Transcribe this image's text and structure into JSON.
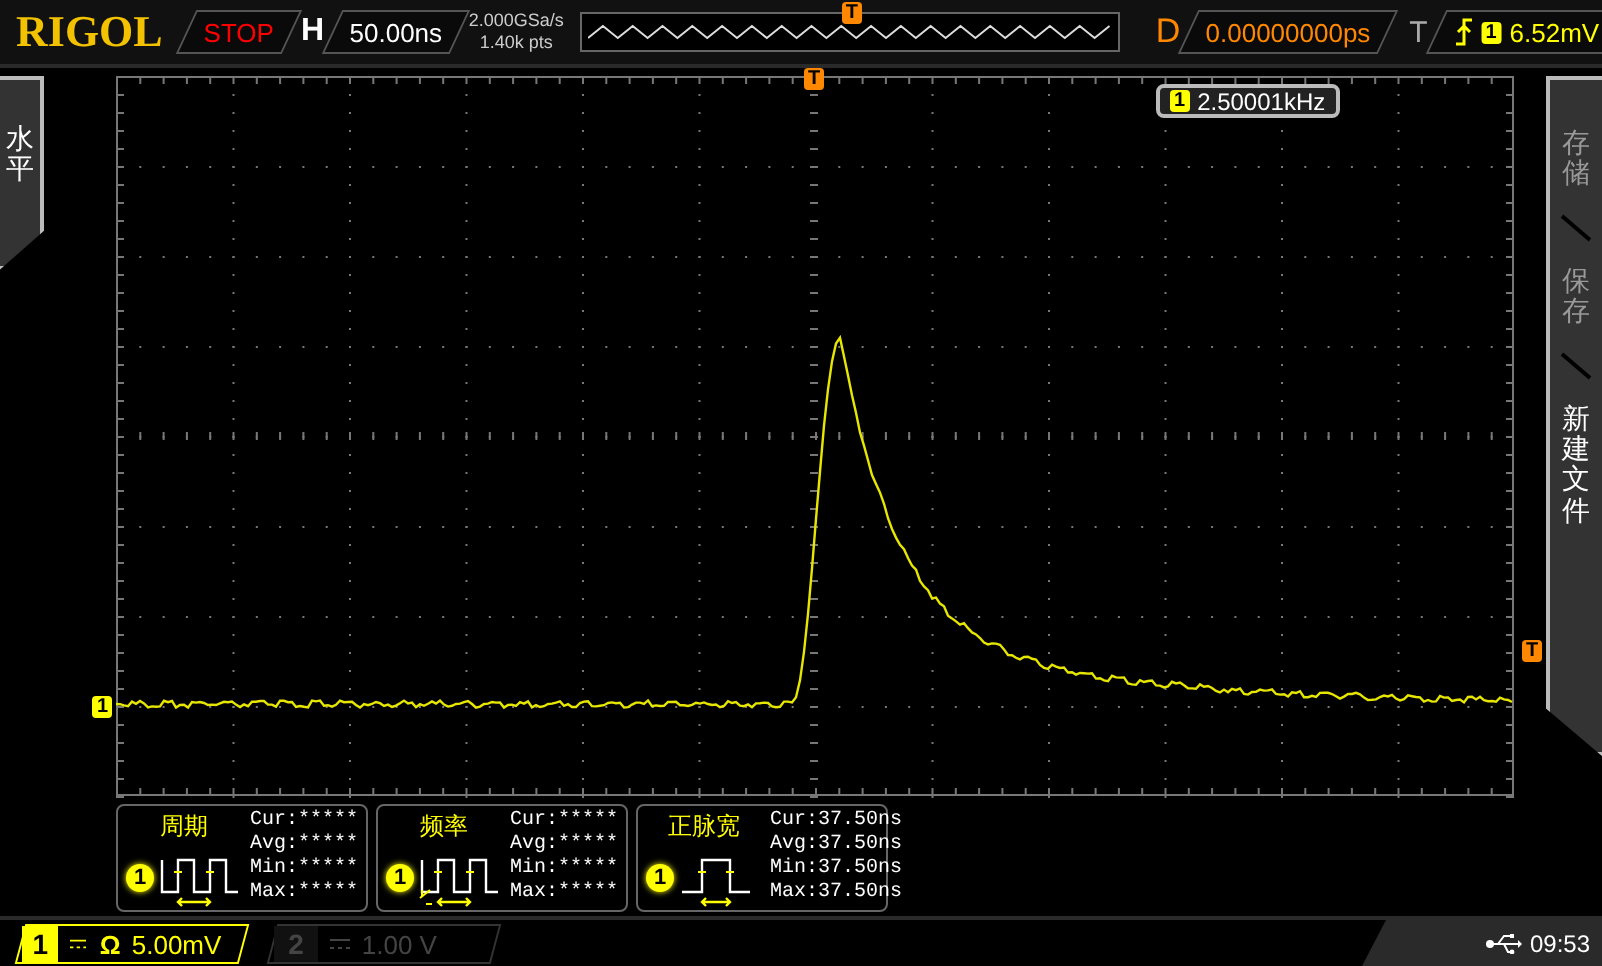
{
  "brand": "RIGOL",
  "run_state": {
    "label": "STOP"
  },
  "horizontal": {
    "label": "H",
    "timebase": "50.00ns"
  },
  "acquisition": {
    "sample_rate": "2.000GSa/s",
    "memory_depth": "1.40k pts"
  },
  "trigger_position_marker": "T",
  "trigger_time_marker": "T",
  "delay": {
    "label": "D",
    "value": "0.00000000ps"
  },
  "trigger": {
    "label": "T",
    "channel": "1",
    "level": "6.52mV"
  },
  "left_menu": {
    "label": "水平"
  },
  "right_menu": {
    "items": [
      {
        "label": "存储",
        "disabled": true
      },
      {
        "label": "保存",
        "disabled": true
      },
      {
        "label": "新建文件",
        "disabled": false
      }
    ]
  },
  "frequency_counter": {
    "channel": "1",
    "value": "2.50001kHz"
  },
  "channel_marker": "1",
  "trigger_level_marker": "T",
  "measurements": [
    {
      "kind": "period",
      "name": "周期",
      "channel": "1",
      "lines": [
        "Cur:*****",
        "Avg:*****",
        "Min:*****",
        "Max:*****"
      ]
    },
    {
      "kind": "frequency",
      "name": "频率",
      "channel": "1",
      "lines": [
        "Cur:*****",
        "Avg:*****",
        "Min:*****",
        "Max:*****"
      ]
    },
    {
      "kind": "pulse",
      "name": "正脉宽",
      "channel": "1",
      "lines": [
        "Cur:37.50ns",
        "Avg:37.50ns",
        "Min:37.50ns",
        "Max:37.50ns"
      ]
    }
  ],
  "channels": [
    {
      "number": "1",
      "enabled": true,
      "impedance": "Ω",
      "scale": "5.00mV"
    },
    {
      "number": "2",
      "enabled": false,
      "scale": "1.00 V"
    }
  ],
  "status": {
    "time": "09:53"
  }
}
